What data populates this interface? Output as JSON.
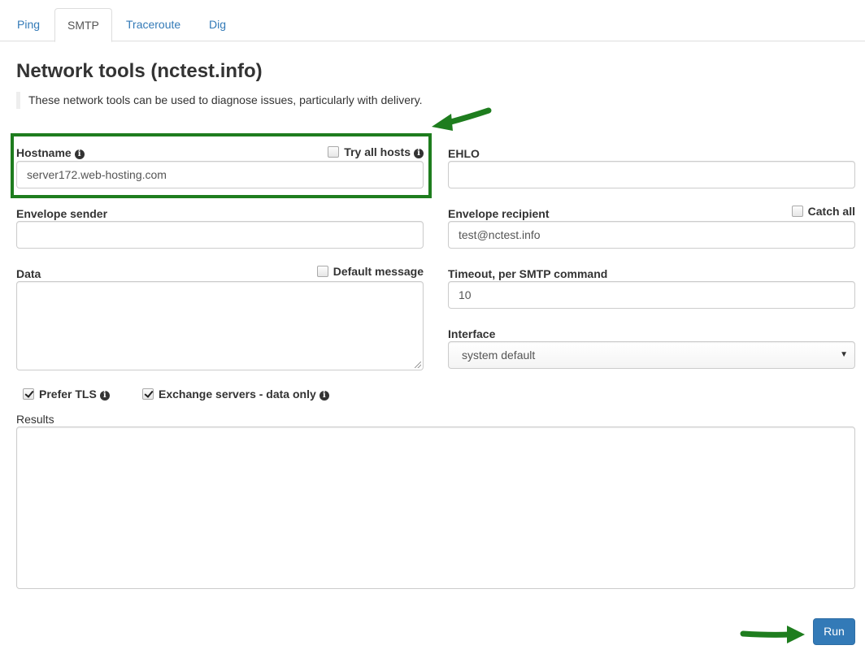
{
  "tabs": [
    {
      "label": "Ping"
    },
    {
      "label": "SMTP",
      "active": true
    },
    {
      "label": "Traceroute"
    },
    {
      "label": "Dig"
    }
  ],
  "page": {
    "title": "Network tools (nctest.info)",
    "description": "These network tools can be used to diagnose issues, particularly with delivery."
  },
  "form": {
    "hostname": {
      "label": "Hostname",
      "value": "server172.web-hosting.com"
    },
    "try_all_hosts": {
      "label": "Try all hosts",
      "checked": false
    },
    "ehlo": {
      "label": "EHLO",
      "value": ""
    },
    "envelope_sender": {
      "label": "Envelope sender",
      "value": ""
    },
    "envelope_recipient": {
      "label": "Envelope recipient",
      "value": "test@nctest.info"
    },
    "catch_all": {
      "label": "Catch all",
      "checked": false
    },
    "data": {
      "label": "Data",
      "value": ""
    },
    "default_message": {
      "label": "Default message",
      "checked": false
    },
    "timeout": {
      "label": "Timeout, per SMTP command",
      "value": "10"
    },
    "interface": {
      "label": "Interface",
      "value": "system default"
    },
    "prefer_tls": {
      "label": "Prefer TLS",
      "checked": true
    },
    "exchange_servers": {
      "label": "Exchange servers - data only",
      "checked": true
    },
    "results": {
      "label": "Results",
      "value": ""
    },
    "run_label": "Run"
  },
  "colors": {
    "link": "#337ab7",
    "primary_button": "#337ab7",
    "annotation_green": "#1e7d1e"
  },
  "icons": {
    "info": "info-circle-icon",
    "arrow": "annotation-arrow-icon"
  }
}
